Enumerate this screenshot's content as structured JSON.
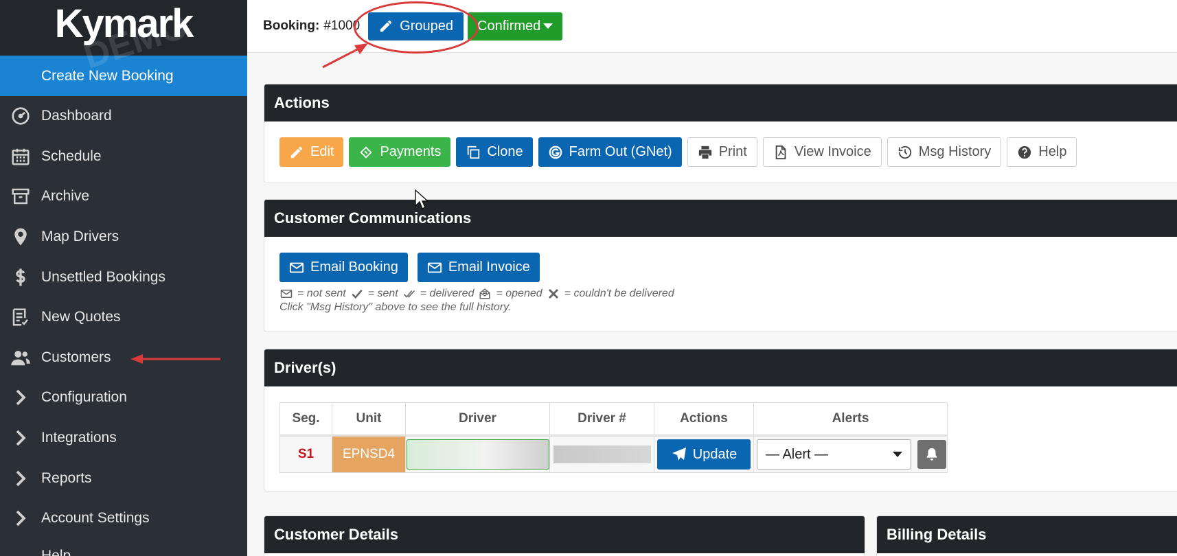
{
  "sidebar": {
    "logo": "Kymark",
    "create_label": "Create New Booking",
    "items": [
      {
        "label": "Dashboard",
        "icon": "speedometer-icon"
      },
      {
        "label": "Schedule",
        "icon": "calendar-icon"
      },
      {
        "label": "Archive",
        "icon": "archive-icon"
      },
      {
        "label": "Map Drivers",
        "icon": "map-pin-icon"
      },
      {
        "label": "Unsettled Bookings",
        "icon": "dollar-icon"
      },
      {
        "label": "New Quotes",
        "icon": "quote-list-icon"
      },
      {
        "label": "Customers",
        "icon": "users-icon"
      },
      {
        "label": "Configuration",
        "icon": "chevron-right-icon"
      },
      {
        "label": "Integrations",
        "icon": "chevron-right-icon"
      },
      {
        "label": "Reports",
        "icon": "chevron-right-icon"
      },
      {
        "label": "Account Settings",
        "icon": "chevron-right-icon"
      }
    ],
    "cut_label": "Help"
  },
  "topbar": {
    "booking_label": "Booking:",
    "booking_number": "#1000",
    "grouped_label": "Grouped",
    "status_label": "Confirmed"
  },
  "actions": {
    "title": "Actions",
    "buttons": {
      "edit": "Edit",
      "payments": "Payments",
      "clone": "Clone",
      "farm_out": "Farm Out (GNet)",
      "print": "Print",
      "view_invoice": "View Invoice",
      "msg_history": "Msg History",
      "help": "Help"
    }
  },
  "communications": {
    "title": "Customer Communications",
    "email_booking": "Email Booking",
    "email_invoice": "Email Invoice",
    "legend": {
      "not_sent": "= not sent",
      "sent": "= sent",
      "delivered": "= delivered",
      "opened": "= opened",
      "failed": "= couldn't be delivered"
    },
    "note": "Click \"Msg History\" above to see the full history."
  },
  "drivers": {
    "title": "Driver(s)",
    "columns": [
      "Seg.",
      "Unit",
      "Driver",
      "Driver #",
      "Actions",
      "Alerts"
    ],
    "rows": [
      {
        "seg": "S1",
        "unit": "EPNSD4",
        "update_label": "Update",
        "alert_placeholder": "— Alert —"
      }
    ]
  },
  "customer_details": {
    "title": "Customer Details"
  },
  "billing_details": {
    "title": "Billing Details"
  },
  "colors": {
    "sidebar_bg": "#2b2f36",
    "create_bg": "#1b84d2",
    "primary_blue": "#0b66b1",
    "success_green": "#1f9c2a",
    "edit_orange": "#f8a64a",
    "payments_green": "#3bb44a",
    "annotation_red": "#d93a3a"
  }
}
